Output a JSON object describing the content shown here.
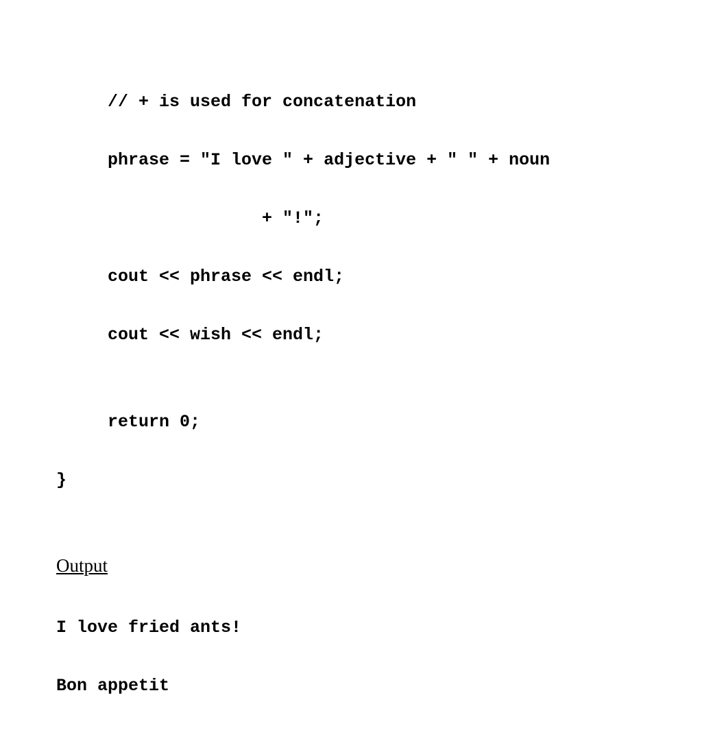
{
  "code": {
    "line1": "     // + is used for concatenation",
    "line2": "     phrase = \"I love \" + adjective + \" \" + noun",
    "line3": "                    + \"!\";",
    "line4": "     cout << phrase << endl;",
    "line5": "     cout << wish << endl;",
    "line6": "",
    "line7": "     return 0;",
    "line8": "}"
  },
  "output": {
    "heading": "Output",
    "line1": "I love fried ants!",
    "line2": "Bon appetit"
  }
}
